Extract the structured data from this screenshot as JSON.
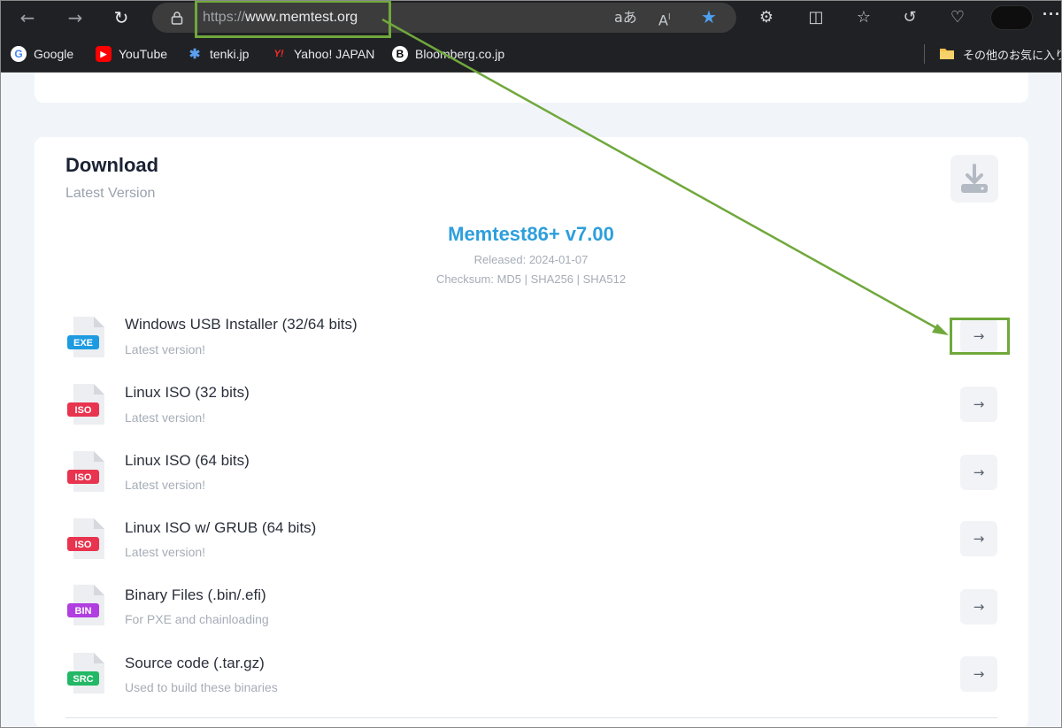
{
  "browser": {
    "url_protocol": "https://",
    "url_host": "www.memtest.org"
  },
  "bookmarks": [
    {
      "label": "Google",
      "icon": "google-icon",
      "glyph": "G"
    },
    {
      "label": "YouTube",
      "icon": "youtube-icon",
      "glyph": "▶"
    },
    {
      "label": "tenki.jp",
      "icon": "tenki-icon",
      "glyph": "✱"
    },
    {
      "label": "Yahoo! JAPAN",
      "icon": "yahoo-icon",
      "glyph": "Y!"
    },
    {
      "label": "Bloomberg.co.jp",
      "icon": "bloomberg-icon",
      "glyph": "B"
    },
    {
      "label": "その他のお気に入り",
      "icon": "folder-icon",
      "glyph": ""
    }
  ],
  "download": {
    "title": "Download",
    "subtitle": "Latest Version",
    "version": "Memtest86+ v7.00",
    "released": "Released: 2024-01-07",
    "checksum": "Checksum: MD5 | SHA256 | SHA512",
    "items": [
      {
        "title": "Windows USB Installer (32/64 bits)",
        "desc": "Latest version!",
        "tag": "EXE"
      },
      {
        "title": "Linux ISO (32 bits)",
        "desc": "Latest version!",
        "tag": "ISO"
      },
      {
        "title": "Linux ISO (64 bits)",
        "desc": "Latest version!",
        "tag": "ISO"
      },
      {
        "title": "Linux ISO w/ GRUB (64 bits)",
        "desc": "Latest version!",
        "tag": "ISO"
      },
      {
        "title": "Binary Files (.bin/.efi)",
        "desc": "For PXE and chainloading",
        "tag": "BIN"
      },
      {
        "title": "Source code (.tar.gz)",
        "desc": "Used to build these binaries",
        "tag": "SRC"
      }
    ]
  },
  "colors": {
    "annotation": "#70a83c",
    "version_blue": "#2d9fdc",
    "exe": "#1e9be0",
    "iso": "#e8344e",
    "bin": "#b03ee0",
    "src": "#22b866"
  }
}
